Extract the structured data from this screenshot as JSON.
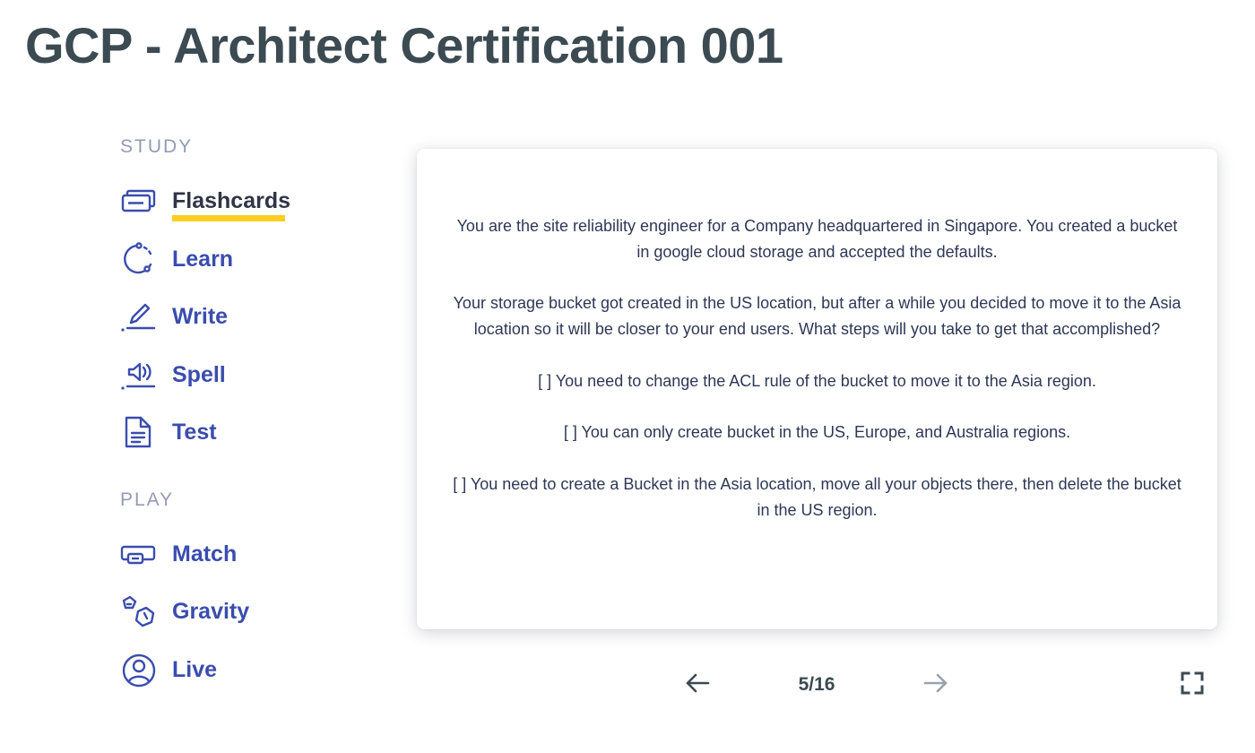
{
  "page": {
    "title": "GCP - Architect Certification 001"
  },
  "sidebar": {
    "study_label": "STUDY",
    "play_label": "PLAY",
    "study_items": [
      {
        "label": "Flashcards",
        "icon": "flashcards-icon",
        "active": true
      },
      {
        "label": "Learn",
        "icon": "learn-icon",
        "active": false
      },
      {
        "label": "Write",
        "icon": "write-icon",
        "active": false
      },
      {
        "label": "Spell",
        "icon": "spell-icon",
        "active": false
      },
      {
        "label": "Test",
        "icon": "test-icon",
        "active": false
      }
    ],
    "play_items": [
      {
        "label": "Match",
        "icon": "match-icon"
      },
      {
        "label": "Gravity",
        "icon": "gravity-icon"
      },
      {
        "label": "Live",
        "icon": "live-icon"
      }
    ]
  },
  "card": {
    "paragraphs": [
      "You are the site reliability engineer for a Company headquartered in Singapore. You created a bucket in google cloud storage and accepted the defaults.",
      "Your storage bucket got created in the US location, but after a while you decided to move it to the Asia location so it will be closer to your end users. What steps will you take to get that accomplished?",
      "[ ] You need to change the ACL rule of the bucket to move it to the Asia region.",
      "[ ] You can only create bucket in the US, Europe, and Australia regions.",
      "[ ] You need to create a Bucket in the Asia location, move all your objects there, then delete the bucket in the US region."
    ]
  },
  "controls": {
    "counter": "5/16",
    "prev_icon": "arrow-left-icon",
    "next_icon": "arrow-right-icon",
    "fullscreen_icon": "fullscreen-icon"
  },
  "colors": {
    "title": "#3c4a52",
    "nav_link": "#3a4dae",
    "active_underline": "#ffcd1f",
    "section_label": "#939bb4",
    "card_text": "#2e3856"
  }
}
